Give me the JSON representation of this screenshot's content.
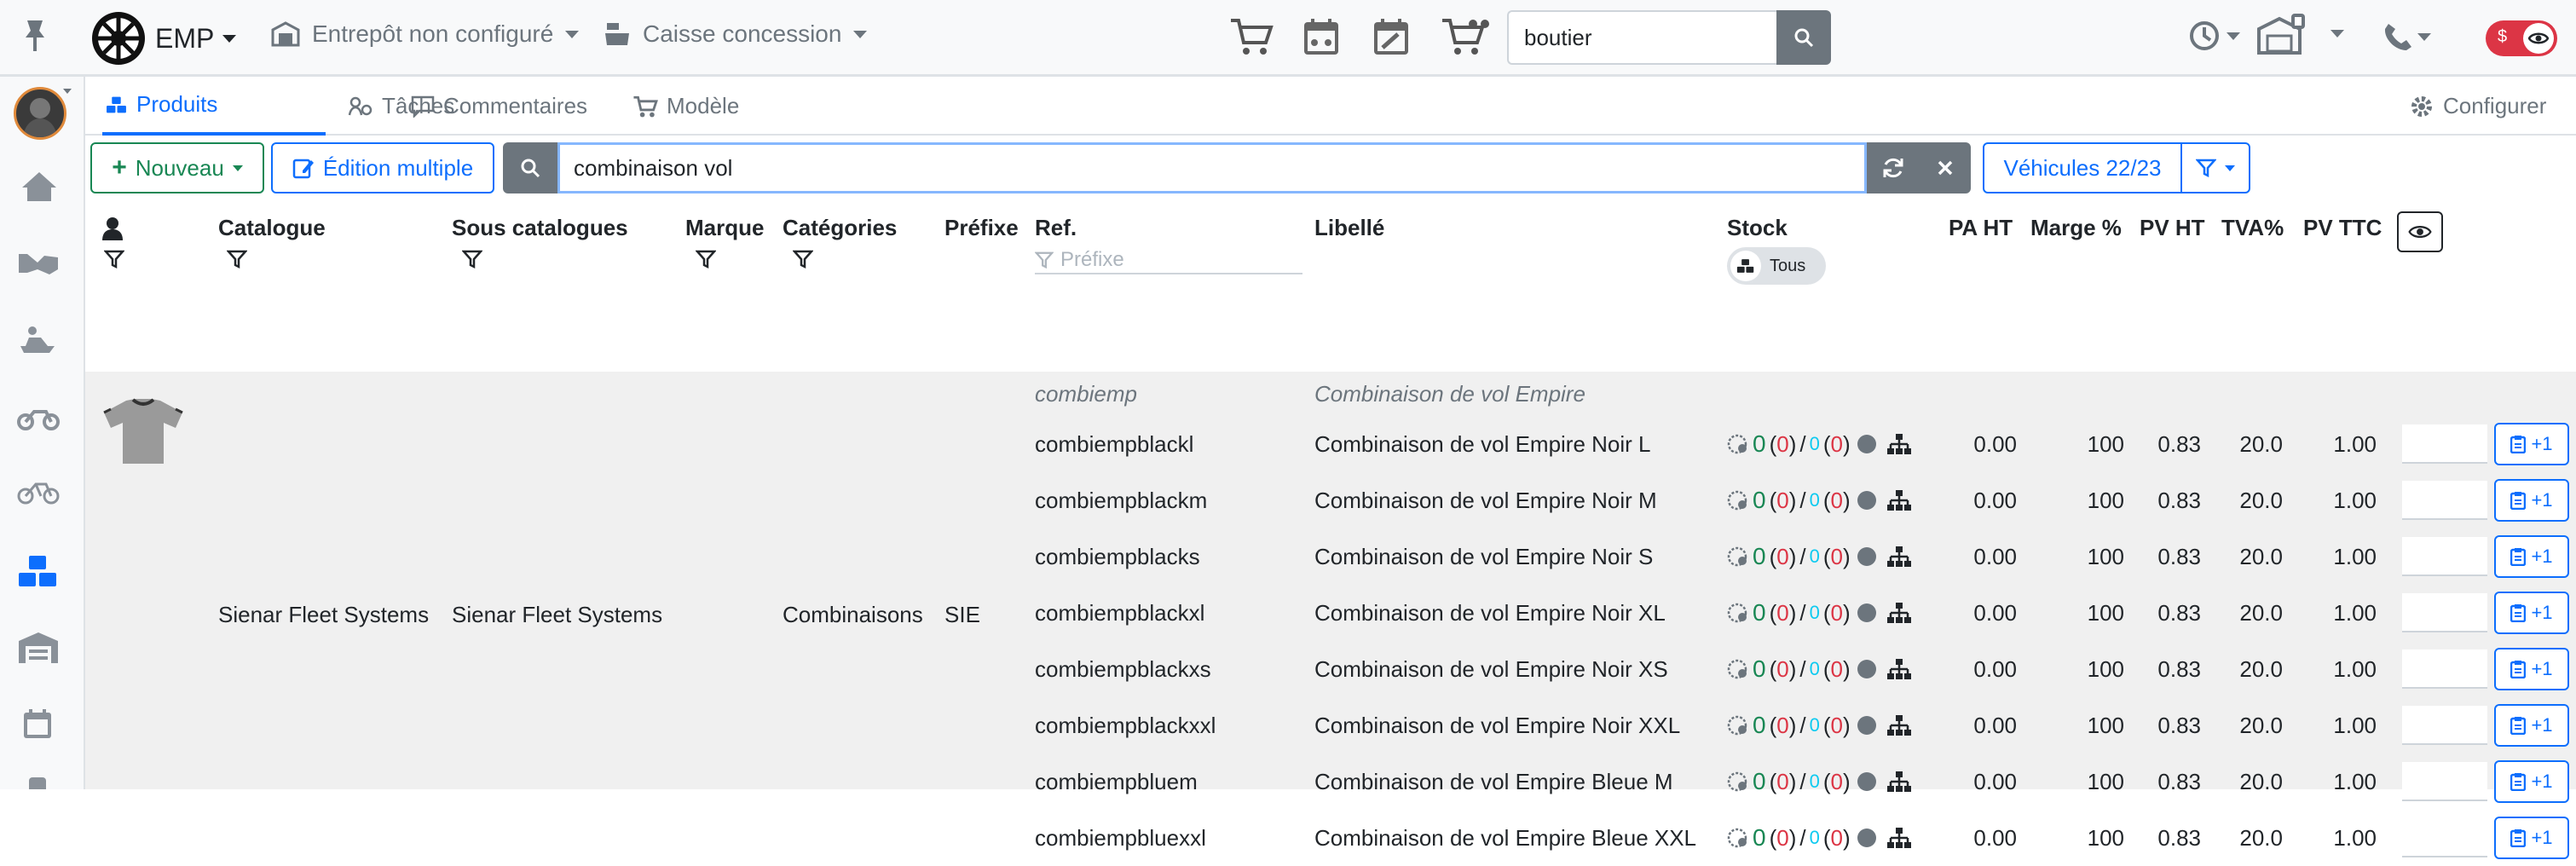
{
  "topbar": {
    "brand": "EMP",
    "warehouse": "Entrepôt non configuré",
    "register": "Caisse concession",
    "search_value": "boutier",
    "icons": [
      "pin-icon",
      "store-icon",
      "cart-icon",
      "calendar-moto-icon",
      "calendar-wrench-icon",
      "cart-moto-icon",
      "history-icon",
      "warehouse-icon",
      "phone-icon",
      "privacy-toggle-icon"
    ]
  },
  "tabs": [
    {
      "label": "Produits",
      "icon": "cubes-icon",
      "active": true
    },
    {
      "label": "Tâches",
      "icon": "tasks-icon",
      "active": false
    },
    {
      "label": "Commentaires",
      "icon": "comment-icon",
      "active": false
    },
    {
      "label": "Modèle",
      "icon": "cart-icon",
      "active": false
    }
  ],
  "configure_label": "Configurer",
  "toolbar": {
    "new_label": "Nouveau",
    "multi_edit_label": "Édition multiple",
    "search_value": "combinaison vol",
    "vehicles_label": "Véhicules 22/23"
  },
  "columns": {
    "catalogue": "Catalogue",
    "sous_catalogues": "Sous catalogues",
    "marque": "Marque",
    "categories": "Catégories",
    "prefixe": "Préfixe",
    "ref": "Ref.",
    "ref_placeholder": "Préfixe",
    "libelle": "Libellé",
    "stock": "Stock",
    "stock_toggle": "Tous",
    "pa_ht": "PA HT",
    "marge": "Marge %",
    "pv_ht": "PV HT",
    "tva": "TVA%",
    "pv_ttc": "PV TTC"
  },
  "group": {
    "catalogue": "Sienar Fleet Systems",
    "sous_catalogue": "Sienar Fleet Systems",
    "categorie": "Combinaisons",
    "prefixe": "SIE",
    "parent_ref": "combiemp",
    "parent_label": "Combinaison de vol Empire"
  },
  "plus_label": "+1",
  "rows": [
    {
      "ref": "combiempblackl",
      "label": "Combinaison de vol Empire Noir L",
      "s1": "0",
      "s2": "0",
      "s3": "0",
      "s4": "0",
      "pa": "0.00",
      "marge": "100",
      "pvht": "0.83",
      "tva": "20.0",
      "pvttc": "1.00"
    },
    {
      "ref": "combiempblackm",
      "label": "Combinaison de vol Empire Noir M",
      "s1": "0",
      "s2": "0",
      "s3": "0",
      "s4": "0",
      "pa": "0.00",
      "marge": "100",
      "pvht": "0.83",
      "tva": "20.0",
      "pvttc": "1.00"
    },
    {
      "ref": "combiempblacks",
      "label": "Combinaison de vol Empire Noir S",
      "s1": "0",
      "s2": "0",
      "s3": "0",
      "s4": "0",
      "pa": "0.00",
      "marge": "100",
      "pvht": "0.83",
      "tva": "20.0",
      "pvttc": "1.00"
    },
    {
      "ref": "combiempblackxl",
      "label": "Combinaison de vol Empire Noir XL",
      "s1": "0",
      "s2": "0",
      "s3": "0",
      "s4": "0",
      "pa": "0.00",
      "marge": "100",
      "pvht": "0.83",
      "tva": "20.0",
      "pvttc": "1.00"
    },
    {
      "ref": "combiempblackxs",
      "label": "Combinaison de vol Empire Noir XS",
      "s1": "0",
      "s2": "0",
      "s3": "0",
      "s4": "0",
      "pa": "0.00",
      "marge": "100",
      "pvht": "0.83",
      "tva": "20.0",
      "pvttc": "1.00"
    },
    {
      "ref": "combiempblackxxl",
      "label": "Combinaison de vol Empire Noir XXL",
      "s1": "0",
      "s2": "0",
      "s3": "0",
      "s4": "0",
      "pa": "0.00",
      "marge": "100",
      "pvht": "0.83",
      "tva": "20.0",
      "pvttc": "1.00"
    },
    {
      "ref": "combiempbluem",
      "label": "Combinaison de vol Empire Bleue M",
      "s1": "0",
      "s2": "0",
      "s3": "0",
      "s4": "0",
      "pa": "0.00",
      "marge": "100",
      "pvht": "0.83",
      "tva": "20.0",
      "pvttc": "1.00"
    },
    {
      "ref": "combiempbluexxl",
      "label": "Combinaison de vol Empire Bleue XXL",
      "s1": "0",
      "s2": "0",
      "s3": "0",
      "s4": "0",
      "pa": "0.00",
      "marge": "100",
      "pvht": "0.83",
      "tva": "20.0",
      "pvttc": "1.00"
    }
  ],
  "sidebar": {
    "items": [
      "home-icon",
      "handshake-icon",
      "jetski-icon",
      "motorcycle-icon",
      "bicycle-icon",
      "cubes-icon",
      "warehouse-icon",
      "calendar-icon"
    ],
    "active_item": "cubes-icon"
  },
  "colors": {
    "primary": "#0d6efd",
    "success": "#198754",
    "danger": "#dc3545",
    "muted": "#6c757d"
  }
}
